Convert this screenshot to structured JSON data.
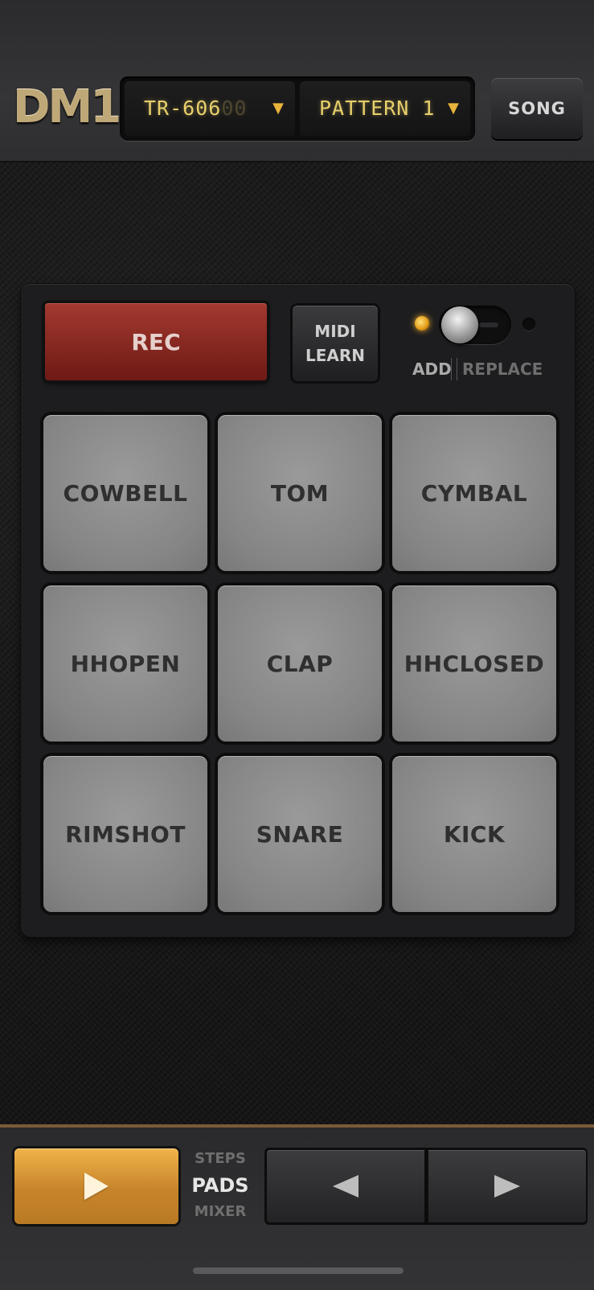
{
  "header": {
    "logo": "DM1",
    "kit": {
      "label": "TR-606",
      "suffix": "00",
      "caret": "▼"
    },
    "pattern": {
      "label": "PATTERN 1",
      "caret": "▼"
    },
    "song_label": "SONG"
  },
  "controls": {
    "rec_label": "REC",
    "midi_line1": "MIDI",
    "midi_line2": "LEARN",
    "toggle": {
      "left_label": "ADD",
      "right_label": "REPLACE",
      "selected": "ADD"
    }
  },
  "pads": [
    {
      "label": "COWBELL"
    },
    {
      "label": "TOM"
    },
    {
      "label": "CYMBAL"
    },
    {
      "label": "HHOPEN"
    },
    {
      "label": "CLAP"
    },
    {
      "label": "HHCLOSED"
    },
    {
      "label": "RIMSHOT"
    },
    {
      "label": "SNARE"
    },
    {
      "label": "KICK"
    }
  ],
  "footer": {
    "modes": {
      "steps": "STEPS",
      "pads": "PADS",
      "mixer": "MIXER",
      "active": "PADS"
    },
    "icons": {
      "play": "play-icon",
      "prev": "arrow-left-icon",
      "next": "arrow-right-icon"
    }
  },
  "colors": {
    "accent": "#e0a33c",
    "rec": "#8a2a22",
    "lcd_text": "#e7cf6a",
    "pad": "#8a8a8a"
  }
}
